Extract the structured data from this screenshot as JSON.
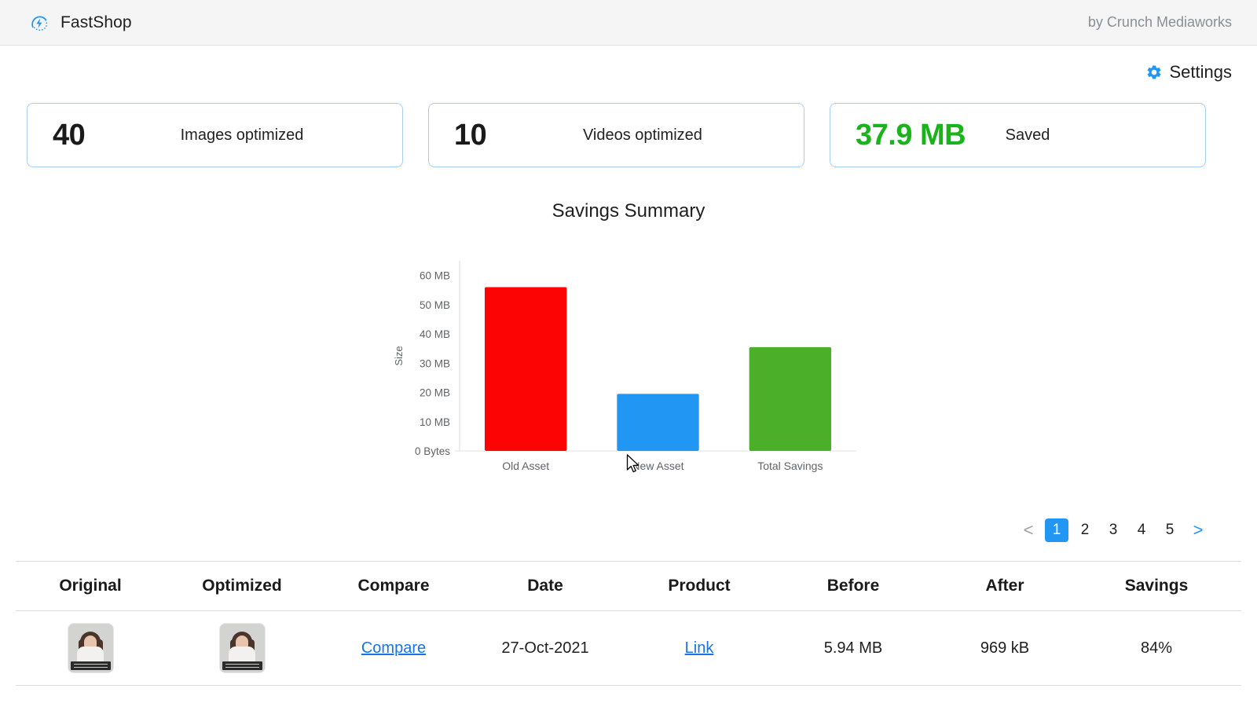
{
  "header": {
    "logo_icon": "speed-gauge-bolt-icon",
    "app_name": "FastShop",
    "byline": "by Crunch Mediaworks"
  },
  "settings": {
    "icon": "gear-icon",
    "label": "Settings"
  },
  "stats": [
    {
      "value": "40",
      "label": "Images optimized",
      "value_color": "#1a1a1a"
    },
    {
      "value": "10",
      "label": "Videos optimized",
      "value_color": "#1a1a1a"
    },
    {
      "value": "37.9 MB",
      "label": "Saved",
      "value_color": "#19b419"
    }
  ],
  "chart_data": {
    "type": "bar",
    "title": "Savings Summary",
    "categories": [
      "Old Asset",
      "New Asset",
      "Total Savings"
    ],
    "values": [
      56,
      19.5,
      35.5
    ],
    "colors": [
      "#fc0404",
      "#2196f3",
      "#4caf2a"
    ],
    "xlabel": "",
    "ylabel": "Size",
    "ylim": [
      0,
      65
    ],
    "yticks": [
      0,
      10,
      20,
      30,
      40,
      50,
      60
    ],
    "ytick_labels": [
      "0 Bytes",
      "10 MB",
      "20 MB",
      "30 MB",
      "40 MB",
      "50 MB",
      "60 MB"
    ],
    "grid": false,
    "legend": false
  },
  "pagination": {
    "prev": "<",
    "next": ">",
    "pages": [
      "1",
      "2",
      "3",
      "4",
      "5"
    ],
    "active": "1",
    "active_color": "#2196f3"
  },
  "table": {
    "headers": [
      "Original",
      "Optimized",
      "Compare",
      "Date",
      "Product",
      "Before",
      "After",
      "Savings"
    ],
    "rows": [
      {
        "original": "thumbnail-image",
        "optimized": "thumbnail-image",
        "compare": "Compare",
        "date": "27-Oct-2021",
        "product": "Link",
        "before": "5.94 MB",
        "after": "969 kB",
        "savings": "84%"
      }
    ]
  }
}
